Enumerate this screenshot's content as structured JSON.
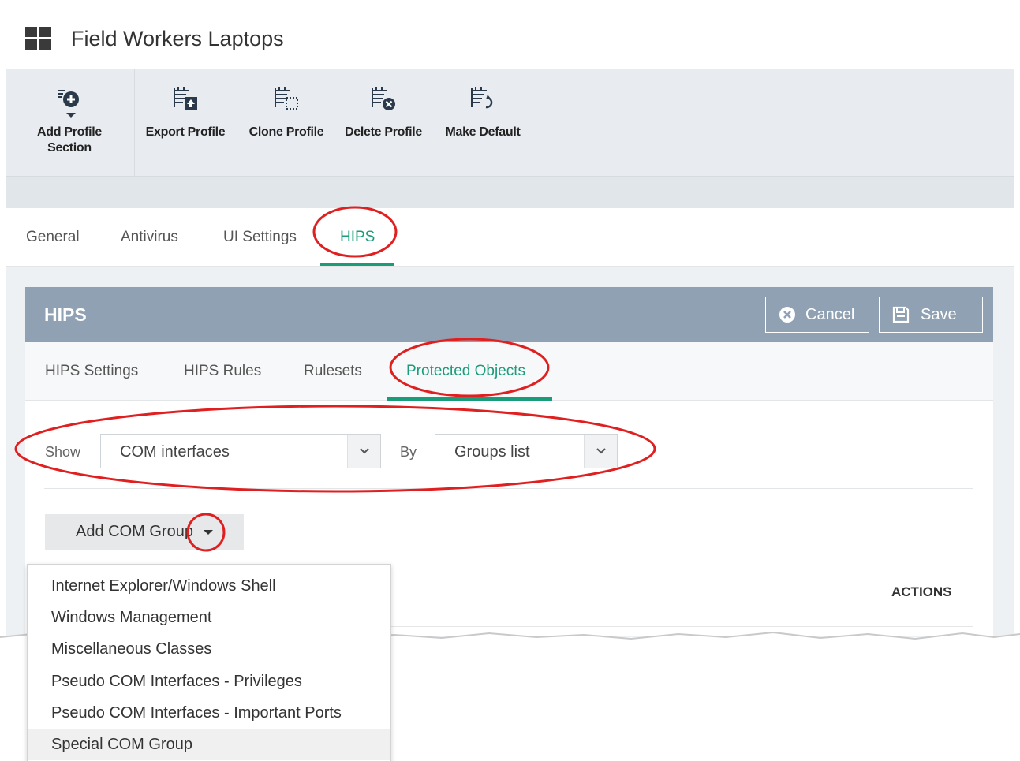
{
  "header": {
    "title": "Field Workers Laptops",
    "logo_icon": "windows-logo-icon"
  },
  "toolbar": {
    "items": [
      {
        "label_line1": "Add Profile",
        "label_line2": "Section",
        "icon": "add-section-icon"
      },
      {
        "label": "Export Profile",
        "icon": "export-icon"
      },
      {
        "label": "Clone Profile",
        "icon": "clone-icon"
      },
      {
        "label": "Delete Profile",
        "icon": "delete-icon"
      },
      {
        "label": "Make Default",
        "icon": "make-default-icon"
      }
    ]
  },
  "tabs": {
    "items": [
      {
        "label": "General"
      },
      {
        "label": "Antivirus"
      },
      {
        "label": "UI Settings"
      },
      {
        "label": "HIPS"
      }
    ],
    "active": "HIPS"
  },
  "panel": {
    "title": "HIPS",
    "cancel_label": "Cancel",
    "save_label": "Save",
    "subtabs": [
      {
        "label": "HIPS Settings"
      },
      {
        "label": "HIPS Rules"
      },
      {
        "label": "Rulesets"
      },
      {
        "label": "Protected Objects"
      }
    ],
    "active_subtab": "Protected Objects"
  },
  "filters": {
    "show_label": "Show",
    "show_value": "COM interfaces",
    "by_label": "By",
    "by_value": "Groups list"
  },
  "add_button": {
    "label": "Add COM Group"
  },
  "table": {
    "actions_header": "ACTIONS"
  },
  "menu": {
    "items": [
      {
        "label": "Internet Explorer/Windows Shell"
      },
      {
        "label": "Windows Management"
      },
      {
        "label": "Miscellaneous Classes"
      },
      {
        "label": "Pseudo COM Interfaces - Privileges"
      },
      {
        "label": "Pseudo COM Interfaces - Important Ports"
      },
      {
        "label": "Special COM Group"
      }
    ],
    "hovered": "Special COM Group"
  },
  "colors": {
    "accent": "#1a9c7a",
    "panel_header": "#8fa1b2",
    "annotation": "#e02020"
  }
}
